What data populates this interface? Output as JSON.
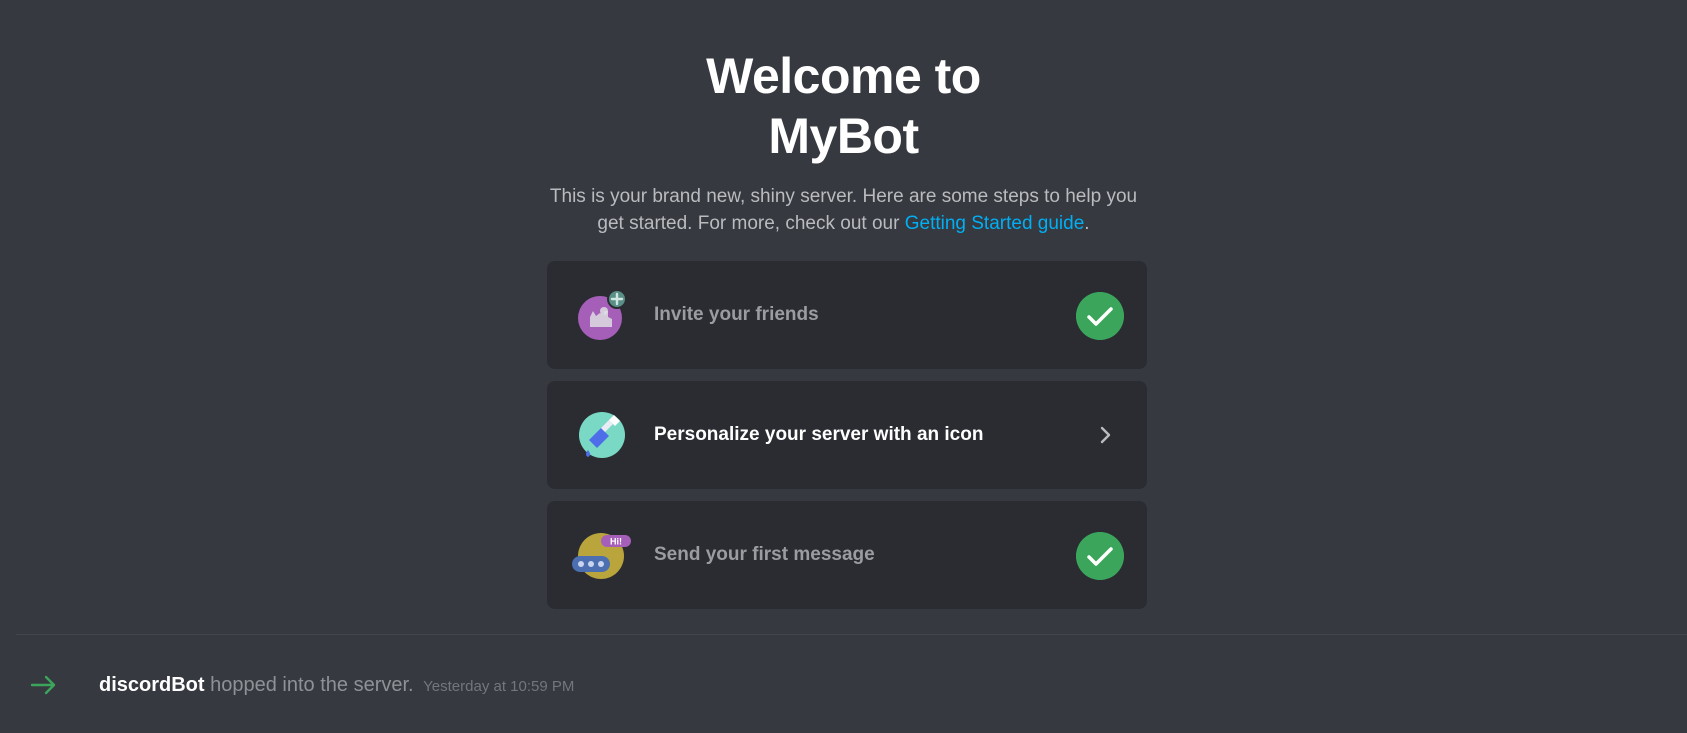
{
  "welcome": {
    "title_line1": "Welcome to",
    "title_line2": "MyBot",
    "subtitle_text": "This is your brand new, shiny server. Here are some steps to help you get started. For more, check out our ",
    "guide_link": "Getting Started guide",
    "subtitle_end": "."
  },
  "checklist": {
    "items": [
      {
        "label": "Invite your friends",
        "icon": "invite-friends-icon",
        "status": "completed",
        "status_icon": "checkmark-icon"
      },
      {
        "label": "Personalize your server with an icon",
        "icon": "paintbrush-icon",
        "status": "pending",
        "status_icon": "chevron-right-icon"
      },
      {
        "label": "Send your first message",
        "icon": "chat-bubble-icon",
        "status": "completed",
        "status_icon": "checkmark-icon",
        "badge": "Hi!"
      }
    ]
  },
  "system_message": {
    "icon": "join-arrow-icon",
    "username": "discordBot",
    "text": " hopped into the server.",
    "timestamp": "Yesterday at 10:59 PM"
  },
  "colors": {
    "background": "#36393f",
    "card": "#2a2c31",
    "link": "#00aff4",
    "success": "#3ba55c",
    "invite_avatar": "#a65fb8",
    "personalize_avatar": "#7ad9c5",
    "message_avatar": "#b9a53c"
  }
}
